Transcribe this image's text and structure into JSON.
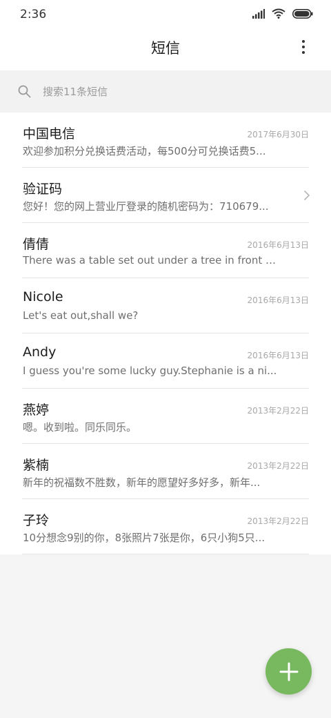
{
  "status_bar": {
    "time": "2:36",
    "icons": [
      "signal-icon",
      "wifi-icon",
      "battery-icon"
    ]
  },
  "header": {
    "title": "短信",
    "menu_icon": "more-vertical-icon"
  },
  "search": {
    "placeholder": "搜索11条短信",
    "value": "",
    "icon": "search-icon"
  },
  "messages": [
    {
      "sender": "中国电信",
      "date": "2017年6月30日",
      "preview": "欢迎参加积分兑换话费活动，每500分可兑换话费5..."
    },
    {
      "sender": "验证码",
      "date": "",
      "preview": "您好！您的网上营业厅登录的随机密码为：710679...",
      "icon": "chevron-right-icon"
    },
    {
      "sender": "倩倩",
      "date": "2016年6月13日",
      "preview": "There was a table set out under a tree in front of ..."
    },
    {
      "sender": "Nicole",
      "date": "2016年6月13日",
      "preview": "Let's eat out,shall we?"
    },
    {
      "sender": "Andy",
      "date": "2016年6月13日",
      "preview": "I guess you're some lucky guy.Stephanie is a ni..."
    },
    {
      "sender": "燕婷",
      "date": "2013年2月22日",
      "preview": "嗯。收到啦。同乐同乐。"
    },
    {
      "sender": "紫楠",
      "date": "2013年2月22日",
      "preview": "新年的祝福数不胜数，新年的愿望好多好多，新年..."
    },
    {
      "sender": "子玲",
      "date": "2013年2月22日",
      "preview": "10分想念9别的你，8张照片7张是你，6只小狗5只..."
    }
  ],
  "fab": {
    "icon": "plus-icon"
  },
  "colors": {
    "accent": "#78b85f",
    "background": "#f5f5f5",
    "search_bar": "#f2f2f2"
  }
}
